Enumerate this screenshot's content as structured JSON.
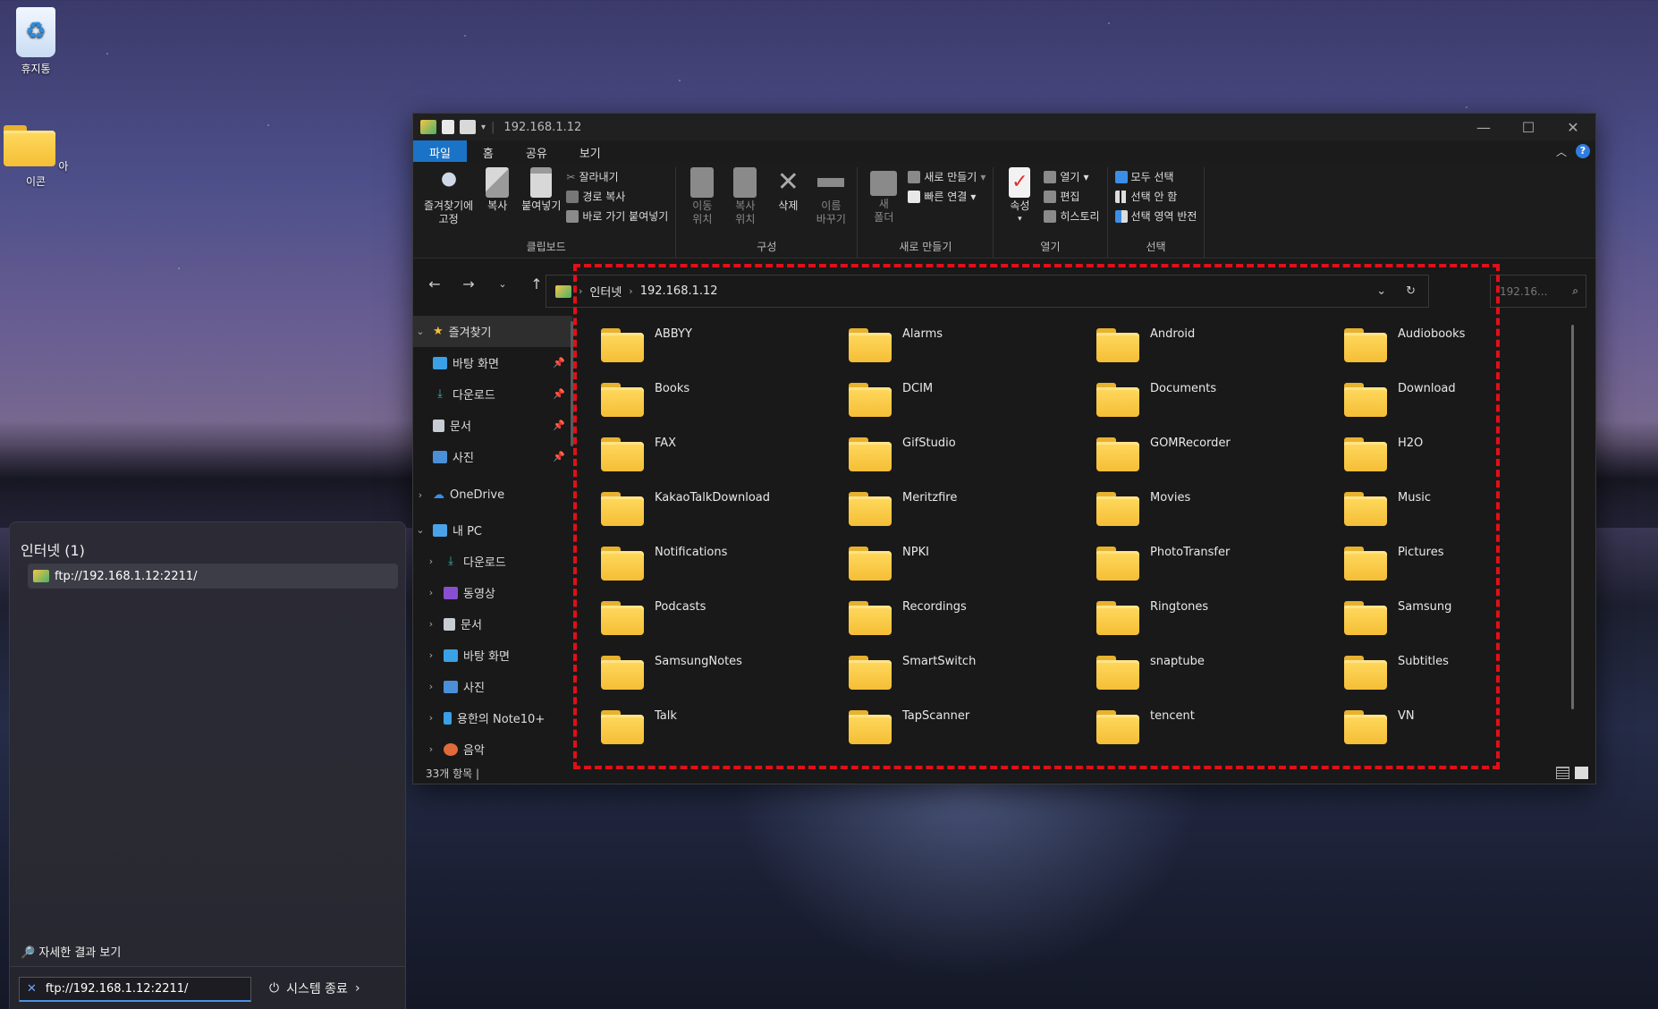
{
  "desktop": {
    "icons": [
      {
        "label": "휴지통"
      },
      {
        "label": "아이콘"
      }
    ]
  },
  "explorer": {
    "title": "192.168.1.12",
    "tabs": [
      "파일",
      "홈",
      "공유",
      "보기"
    ],
    "ribbon": {
      "clipboard": {
        "group": "클립보드",
        "pin": "즐겨찾기에\n고정",
        "copy": "복사",
        "paste": "붙여넣기",
        "cut": "잘라내기",
        "copy_path": "경로 복사",
        "paste_shortcut": "바로 가기 붙여넣기"
      },
      "organize": {
        "group": "구성",
        "move_to": "이동\n위치",
        "copy_to": "복사\n위치",
        "delete": "삭제",
        "rename": "이름\n바꾸기"
      },
      "new": {
        "group": "새로 만들기",
        "new_folder": "새\n폴더",
        "new_item": "새로 만들기",
        "easy_access": "빠른 연결"
      },
      "open": {
        "group": "열기",
        "properties": "속성",
        "open": "열기",
        "edit": "편집",
        "history": "히스토리"
      },
      "select": {
        "group": "선택",
        "select_all": "모두 선택",
        "select_none": "선택 안 함",
        "invert": "선택 영역 반전"
      }
    },
    "address": {
      "crumbs": [
        "인터넷",
        "192.168.1.12"
      ],
      "search_placeholder": "192.16..."
    },
    "nav": [
      {
        "label": "즐겨찾기",
        "arrow": "v"
      },
      {
        "label": "바탕 화면",
        "pin": true
      },
      {
        "label": "다운로드",
        "pin": true
      },
      {
        "label": "문서",
        "pin": true
      },
      {
        "label": "사진",
        "pin": true
      },
      {
        "label": "OneDrive",
        "arrow": ">"
      },
      {
        "label": "내 PC",
        "arrow": "v"
      },
      {
        "label": "다운로드",
        "arrow": ">"
      },
      {
        "label": "동영상",
        "arrow": ">"
      },
      {
        "label": "문서",
        "arrow": ">"
      },
      {
        "label": "바탕 화면",
        "arrow": ">"
      },
      {
        "label": "사진",
        "arrow": ">"
      },
      {
        "label": "용한의 Note10+",
        "arrow": ">"
      },
      {
        "label": "음악",
        "arrow": ">"
      }
    ],
    "folders": [
      "ABBYY",
      "Alarms",
      "Android",
      "Audiobooks",
      "Books",
      "DCIM",
      "Documents",
      "Download",
      "FAX",
      "GifStudio",
      "GOMRecorder",
      "H2O",
      "KakaoTalkDownload",
      "Meritzfire",
      "Movies",
      "Music",
      "Notifications",
      "NPKI",
      "PhotoTransfer",
      "Pictures",
      "Podcasts",
      "Recordings",
      "Ringtones",
      "Samsung",
      "SamsungNotes",
      "SmartSwitch",
      "snaptube",
      "Subtitles",
      "Talk",
      "TapScanner",
      "tencent",
      "VN"
    ],
    "status": "33개 항목  |"
  },
  "start_panel": {
    "section_title": "인터넷 (1)",
    "result": "ftp://192.168.1.12:2211/",
    "more_results": "자세한 결과 보기",
    "search_value": "ftp://192.168.1.12:2211/",
    "power_label": "시스템 종료"
  },
  "colors": {
    "accent": "#1a73c7",
    "highlight_dash": "#e01018",
    "folder": "#f5be36"
  }
}
